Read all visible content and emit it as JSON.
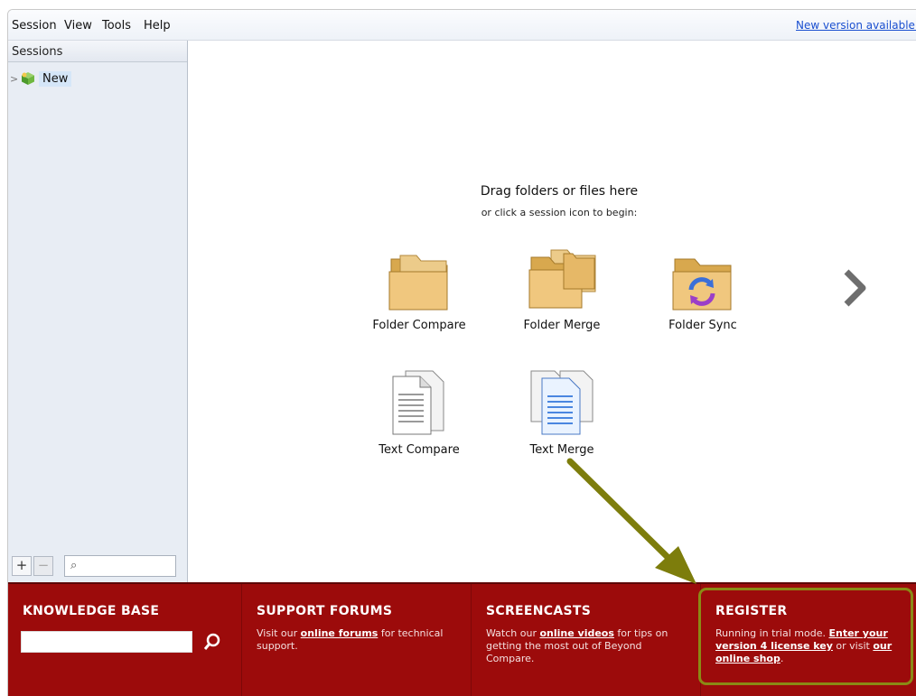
{
  "menubar": {
    "items": [
      "Session",
      "View",
      "Tools",
      "Help"
    ],
    "new_version_label": "New version available."
  },
  "sidebar": {
    "header": "Sessions",
    "tree": [
      {
        "label": "New",
        "icon": "new-session-cube-icon"
      }
    ],
    "add_label": "+",
    "remove_label": "−",
    "filter_placeholder": ""
  },
  "main": {
    "drag_title": "Drag folders or files here",
    "drag_subtitle": "or click a session icon to begin:",
    "sessions": [
      {
        "label": "Folder Compare",
        "icon": "folder-compare-icon"
      },
      {
        "label": "Folder Merge",
        "icon": "folder-merge-icon"
      },
      {
        "label": "Folder Sync",
        "icon": "folder-sync-icon"
      },
      {
        "label": "Text Compare",
        "icon": "text-compare-icon"
      },
      {
        "label": "Text Merge",
        "icon": "text-merge-icon"
      }
    ],
    "next_icon": "chevron-right-icon"
  },
  "footer": {
    "knowledge_base": {
      "title": "KNOWLEDGE BASE",
      "search_placeholder": ""
    },
    "support_forums": {
      "title": "SUPPORT FORUMS",
      "text_before": "Visit our ",
      "link": "online forums",
      "text_after": " for technical support."
    },
    "screencasts": {
      "title": "SCREENCASTS",
      "text_before": "Watch our ",
      "link": "online videos",
      "text_after": " for tips on getting the most out of Beyond Compare."
    },
    "register": {
      "title": "REGISTER",
      "text_before": "Running in trial mode.  ",
      "link1": "Enter your version 4 license key",
      "text_middle": " or visit ",
      "link2": "our online shop",
      "text_after": "."
    }
  },
  "colors": {
    "footer_bg": "#9c0b0b",
    "annotation_arrow": "#7d7d0c",
    "link_blue": "#1a4fd0",
    "sidebar_bg": "#e8edf4"
  }
}
